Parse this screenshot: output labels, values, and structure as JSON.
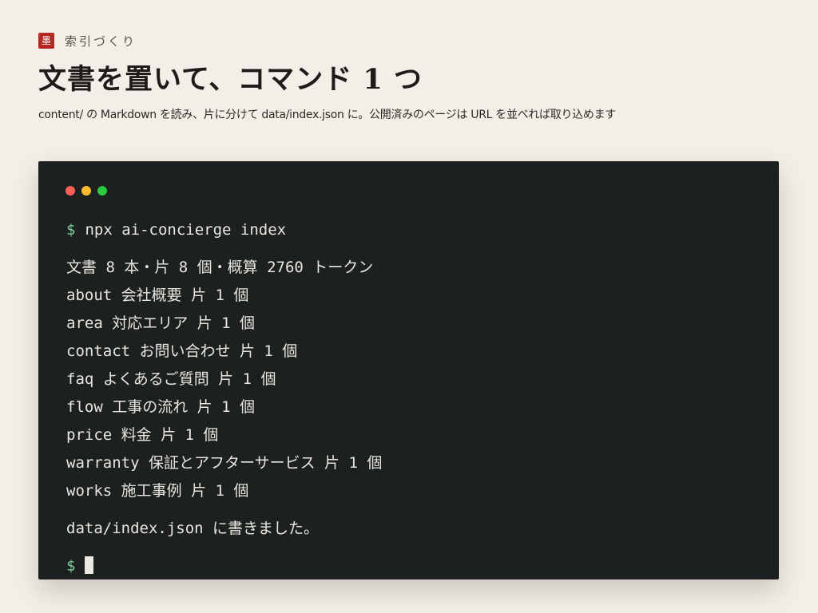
{
  "header": {
    "seal_glyph": "墨",
    "eyebrow": "索引づくり",
    "title": "文書を置いて、コマンド 1 つ",
    "lead": "content/ の Markdown を読み、片に分けて data/index.json に。公開済みのページは URL を並べれば取り込めます"
  },
  "colors": {
    "background": "#f3efe8",
    "seal": "#b42a22",
    "terminal_bg": "#1c201e",
    "prompt": "#7ecb9a",
    "dot_close": "#ff5f57",
    "dot_minimize": "#febc2e",
    "dot_zoom": "#28c840"
  },
  "terminal": {
    "prompt_symbol": "$",
    "command": "npx ai-concierge index",
    "summary": "文書 8 本・片 8 個・概算 2760 トークン",
    "documents": [
      "about 会社概要 片 1 個",
      "area 対応エリア 片 1 個",
      "contact お問い合わせ 片 1 個",
      "faq よくあるご質問 片 1 個",
      "flow 工事の流れ 片 1 個",
      "price 料金 片 1 個",
      "warranty 保証とアフターサービス 片 1 個",
      "works 施工事例 片 1 個"
    ],
    "result": "data/index.json に書きました。",
    "final_prompt": "$"
  }
}
